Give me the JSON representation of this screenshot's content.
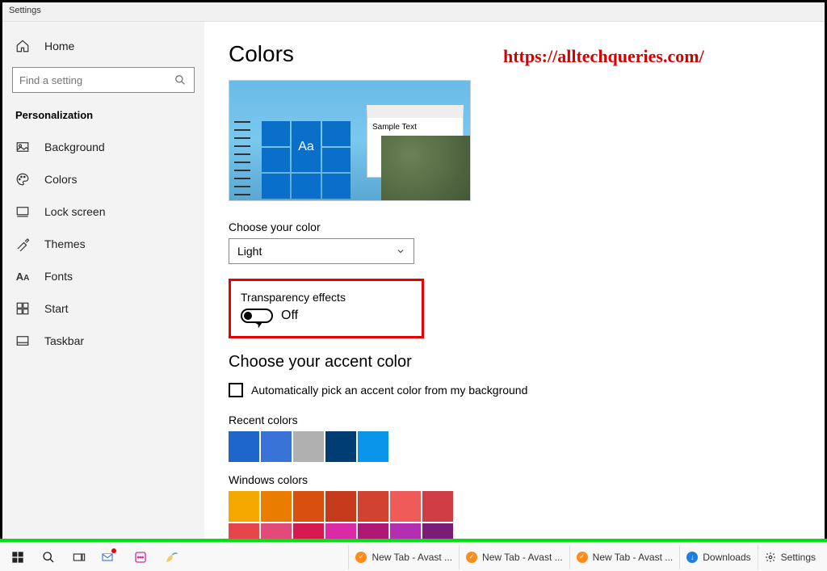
{
  "window": {
    "title": "Settings"
  },
  "sidebar": {
    "home": "Home",
    "search_placeholder": "Find a setting",
    "section": "Personalization",
    "items": [
      {
        "label": "Background",
        "icon": "image-icon"
      },
      {
        "label": "Colors",
        "icon": "palette-icon"
      },
      {
        "label": "Lock screen",
        "icon": "lock-screen-icon"
      },
      {
        "label": "Themes",
        "icon": "themes-icon"
      },
      {
        "label": "Fonts",
        "icon": "fonts-icon"
      },
      {
        "label": "Start",
        "icon": "start-icon"
      },
      {
        "label": "Taskbar",
        "icon": "taskbar-icon"
      }
    ]
  },
  "watermark": "https://alltechqueries.com/",
  "main": {
    "title": "Colors",
    "preview_sample": "Sample Text",
    "preview_tile_text": "Aa",
    "choose_color_label": "Choose your color",
    "choose_color_value": "Light",
    "transparency_label": "Transparency effects",
    "transparency_value": "Off",
    "accent_heading": "Choose your accent color",
    "auto_pick_label": "Automatically pick an accent color from my background",
    "recent_label": "Recent colors",
    "recent_colors": [
      "#1f66cb",
      "#3a73d8",
      "#b0b0b0",
      "#003d73",
      "#0a94ea"
    ],
    "windows_label": "Windows colors",
    "windows_colors_row1": [
      "#f5a800",
      "#ea7d00",
      "#d84f10",
      "#c53a1a",
      "#d14330",
      "#ee5b59",
      "#cf3d45",
      "#e8444b"
    ],
    "windows_colors_row2": [
      "#e24a79",
      "#d6194e",
      "#da2aa5",
      "#b01876",
      "#b32eb0",
      "#7a1d78"
    ]
  },
  "taskbar": {
    "tabs": [
      {
        "label": "New Tab - Avast ...",
        "type": "browser"
      },
      {
        "label": "New Tab - Avast ...",
        "type": "browser"
      },
      {
        "label": "New Tab - Avast ...",
        "type": "browser"
      },
      {
        "label": "Downloads",
        "type": "dl"
      },
      {
        "label": "Settings",
        "type": "settings"
      }
    ]
  }
}
